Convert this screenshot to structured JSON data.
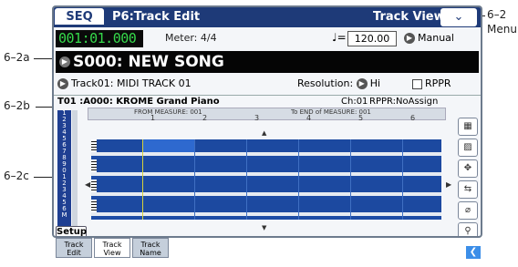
{
  "titlebar": {
    "mode": "SEQ",
    "page": "P6:Track Edit",
    "view": "Track View",
    "menu_symbol": "⌄"
  },
  "row1": {
    "location": "001:01.000",
    "meter": "Meter: 4/4",
    "tempo_icon": "♩=",
    "tempo": "120.00",
    "manual": "Manual"
  },
  "song": {
    "name": "S000: NEW SONG"
  },
  "row3": {
    "track": "Track01: MIDI TRACK 01",
    "resolution_label": "Resolution:",
    "resolution_value": "Hi",
    "rppr": "RPPR"
  },
  "trackinfo": {
    "program": "T01 :A000: KROME Grand Piano",
    "channel": "Ch:01",
    "rppr": "RPPR:NoAssign"
  },
  "measure": {
    "from": "FROM MEASURE: 001",
    "to": "To END of MEASURE: 001",
    "numbers": [
      "1",
      "2",
      "3",
      "4",
      "5",
      "6"
    ]
  },
  "tracklist": {
    "items": [
      "1",
      "2",
      "3",
      "4",
      "5",
      "6",
      "7",
      "8",
      "9",
      "0",
      "1",
      "2",
      "3",
      "4",
      "5",
      "6",
      "M"
    ]
  },
  "setup": "Setup",
  "tools": [
    "▦",
    "▨",
    "✥",
    "⇆",
    "⌀",
    "⚲"
  ],
  "tabs": [
    {
      "line1": "Track",
      "line2": "Edit"
    },
    {
      "line1": "Track",
      "line2": "View"
    },
    {
      "line1": "Track",
      "line2": "Name"
    }
  ],
  "callouts": {
    "c62": "6–2",
    "menu": "Menu",
    "c2a": "6–2a",
    "c2b": "6–2b",
    "c2c": "6–2c"
  },
  "colors": {
    "titlebar": "#1e3a78",
    "location_text": "#36d94b",
    "grid": "#1c49a0"
  }
}
